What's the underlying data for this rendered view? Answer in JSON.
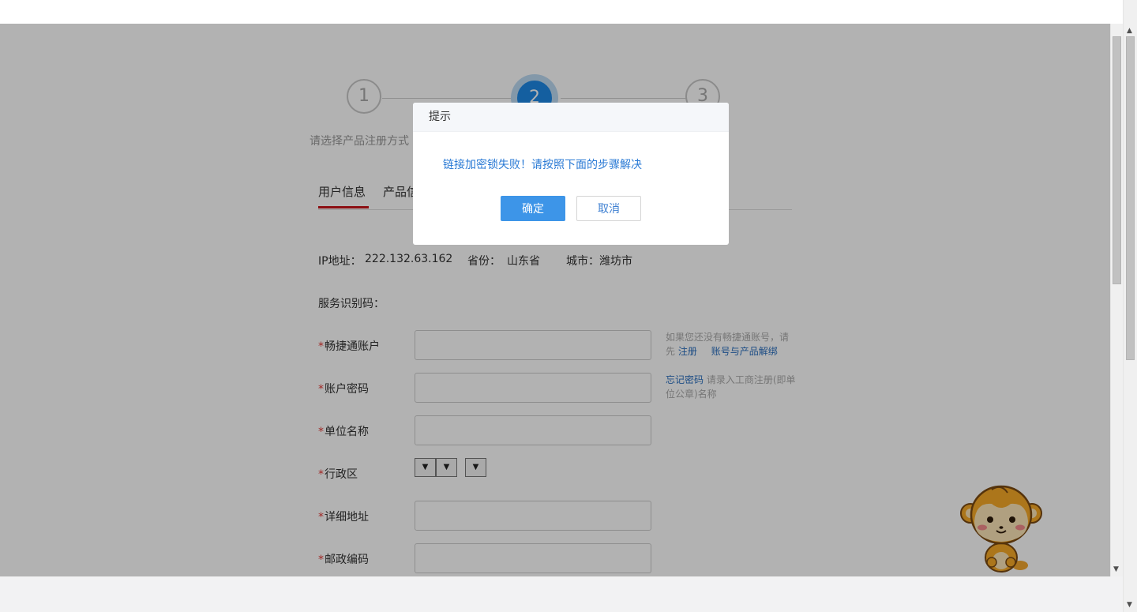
{
  "steps": [
    {
      "number": "1",
      "label": "请选择产品注册方式"
    },
    {
      "number": "2",
      "label": ""
    },
    {
      "number": "3",
      "label": ""
    }
  ],
  "tabs": [
    {
      "label": "用户信息"
    },
    {
      "label": "产品信"
    }
  ],
  "info": {
    "ip_label": "IP地址：",
    "ip_value": "222.132.63.162",
    "province_label": "省份：",
    "province_value": "山东省",
    "city_label": "城市：",
    "city_value": "潍坊市",
    "service_code_label": "服务识别码："
  },
  "form": {
    "required_mark": "*",
    "account_label": "畅捷通账户",
    "password_label": "账户密码",
    "company_label": "单位名称",
    "region_label": "行政区",
    "address_label": "详细地址",
    "postal_label": "邮政编码",
    "select_arrow": "▼"
  },
  "help": {
    "account_text_1": "如果您还没有畅捷通账号，请先",
    "register_link": "注册",
    "unbind_link": "账号与产品解绑",
    "forgot_link": "忘记密码",
    "company_hint": "请录入工商注册(即单位公章)名称"
  },
  "dialog": {
    "title": "提示",
    "message": "链接加密锁失败！请按照下面的步骤解决",
    "ok_label": "确定",
    "cancel_label": "取消"
  },
  "scrollbar": {
    "up": "▲",
    "down": "▼"
  }
}
